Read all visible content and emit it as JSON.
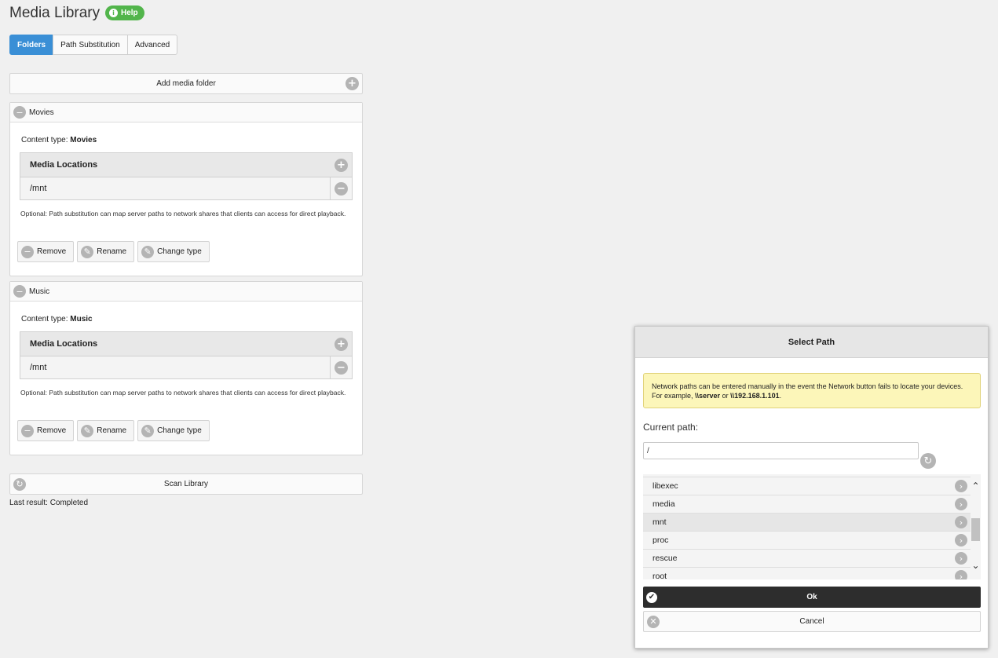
{
  "header": {
    "title": "Media Library",
    "help": "Help"
  },
  "tabs": [
    "Folders",
    "Path Substitution",
    "Advanced"
  ],
  "add_folder": "Add media folder",
  "folders": [
    {
      "name": "Movies",
      "content_type_label": "Content type:",
      "content_type": "Movies",
      "locations_title": "Media Locations",
      "location": "/mnt",
      "note": "Optional: Path substitution can map server paths to network shares that clients can access for direct playback.",
      "actions": [
        "Remove",
        "Rename",
        "Change type"
      ]
    },
    {
      "name": "Music",
      "content_type_label": "Content type:",
      "content_type": "Music",
      "locations_title": "Media Locations",
      "location": "/mnt",
      "note": "Optional: Path substitution can map server paths to network shares that clients can access for direct playback.",
      "actions": [
        "Remove",
        "Rename",
        "Change type"
      ]
    }
  ],
  "scan": {
    "label": "Scan Library",
    "last_result": "Last result: Completed"
  },
  "dialog": {
    "title": "Select Path",
    "info_prefix": "Network paths can be entered manually in the event the Network button fails to locate your devices. For example, ",
    "info_ex1": "\\\\server",
    "info_or": " or ",
    "info_ex2": "\\\\192.168.1.101",
    "info_suffix": ".",
    "current_path_label": "Current path:",
    "current_path": "/",
    "directories": [
      "libexec",
      "media",
      "mnt",
      "proc",
      "rescue",
      "root"
    ],
    "selected_directory": "mnt",
    "ok": "Ok",
    "cancel": "Cancel"
  },
  "colors": {
    "accent": "#3a8fd6",
    "help_green": "#52b54b",
    "info_bg": "#fcf6b9",
    "ok_bg": "#2d2d2d"
  },
  "icons": {
    "add": "plus-circle-icon",
    "remove": "minus-circle-icon",
    "edit": "pencil-icon",
    "refresh": "refresh-icon",
    "chevron": "chevron-right-icon",
    "check": "check-icon",
    "close": "close-icon",
    "info": "info-icon"
  }
}
